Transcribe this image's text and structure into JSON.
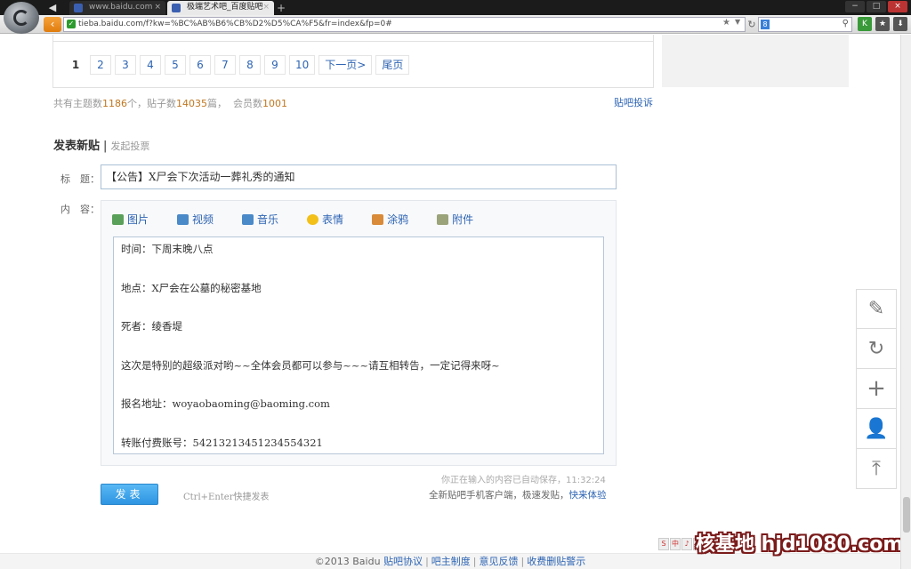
{
  "browser": {
    "tabs": [
      {
        "title": "www.baidu.com"
      },
      {
        "title": "极端艺术吧_百度贴吧"
      }
    ],
    "url": "tieba.baidu.com/f?kw=%BC%AB%B6%CB%D2%D5%CA%F5&fr=index&fp=0#",
    "search_engine_label": "8"
  },
  "pager": {
    "pages": [
      "1",
      "2",
      "3",
      "4",
      "5",
      "6",
      "7",
      "8",
      "9",
      "10"
    ],
    "current": "1",
    "next": "下一页>",
    "last": "尾页"
  },
  "stats": {
    "topics_label": "共有主题数",
    "topics": "1186",
    "topics_unit": "个，贴子数",
    "posts": "14035",
    "posts_unit": "篇，",
    "members_label": "会员数",
    "members": "1001",
    "report": "贴吧投诉"
  },
  "post": {
    "heading": "发表新贴",
    "separator": "|",
    "vote": "发起投票",
    "title_label": "标　题：",
    "title_value": "【公告】X尸会下次活动一葬礼秀的通知",
    "content_label": "内　容：",
    "tools": [
      {
        "label": "图片",
        "icon": "image-icon",
        "color": "#5aa05a"
      },
      {
        "label": "视频",
        "icon": "video-icon",
        "color": "#4a8ac9"
      },
      {
        "label": "音乐",
        "icon": "music-icon",
        "color": "#4a8ac9"
      },
      {
        "label": "表情",
        "icon": "smiley-icon",
        "color": "#f2c019"
      },
      {
        "label": "涂鸦",
        "icon": "paint-icon",
        "color": "#d98b3a"
      },
      {
        "label": "附件",
        "icon": "attachment-icon",
        "color": "#9aa37a"
      }
    ],
    "content_lines": [
      "时间：下周末晚八点",
      "地点：X尸会在公墓的秘密基地",
      "死者：绫香堤",
      "这次是特别的超级派对哟~~全体会员都可以参与~~~请互相转告，一定记得来呀~",
      "报名地址：woyaobaoming@baoming.com",
      "转账付费账号：54213213451234554321"
    ],
    "autosave": "你正在输入的内容已自动保存，11:32:24",
    "submit": "发表",
    "shortcut": "Ctrl+Enter快捷发表",
    "promo_text": "全新贴吧手机客户端，极速发贴，",
    "promo_link": "快来体验"
  },
  "footer": {
    "copyright": "©2013 Baidu",
    "links": [
      "贴吧协议",
      "吧主制度",
      "意见反馈",
      "收费删贴警示"
    ]
  },
  "side_tools": [
    {
      "icon": "edit-icon"
    },
    {
      "icon": "refresh-icon"
    },
    {
      "icon": "plus-icon"
    },
    {
      "icon": "user-icon"
    },
    {
      "icon": "back-to-top-icon"
    }
  ],
  "watermark": "核基地 hjd1080.com",
  "ime": [
    "S",
    "中",
    "♪",
    "☺"
  ]
}
